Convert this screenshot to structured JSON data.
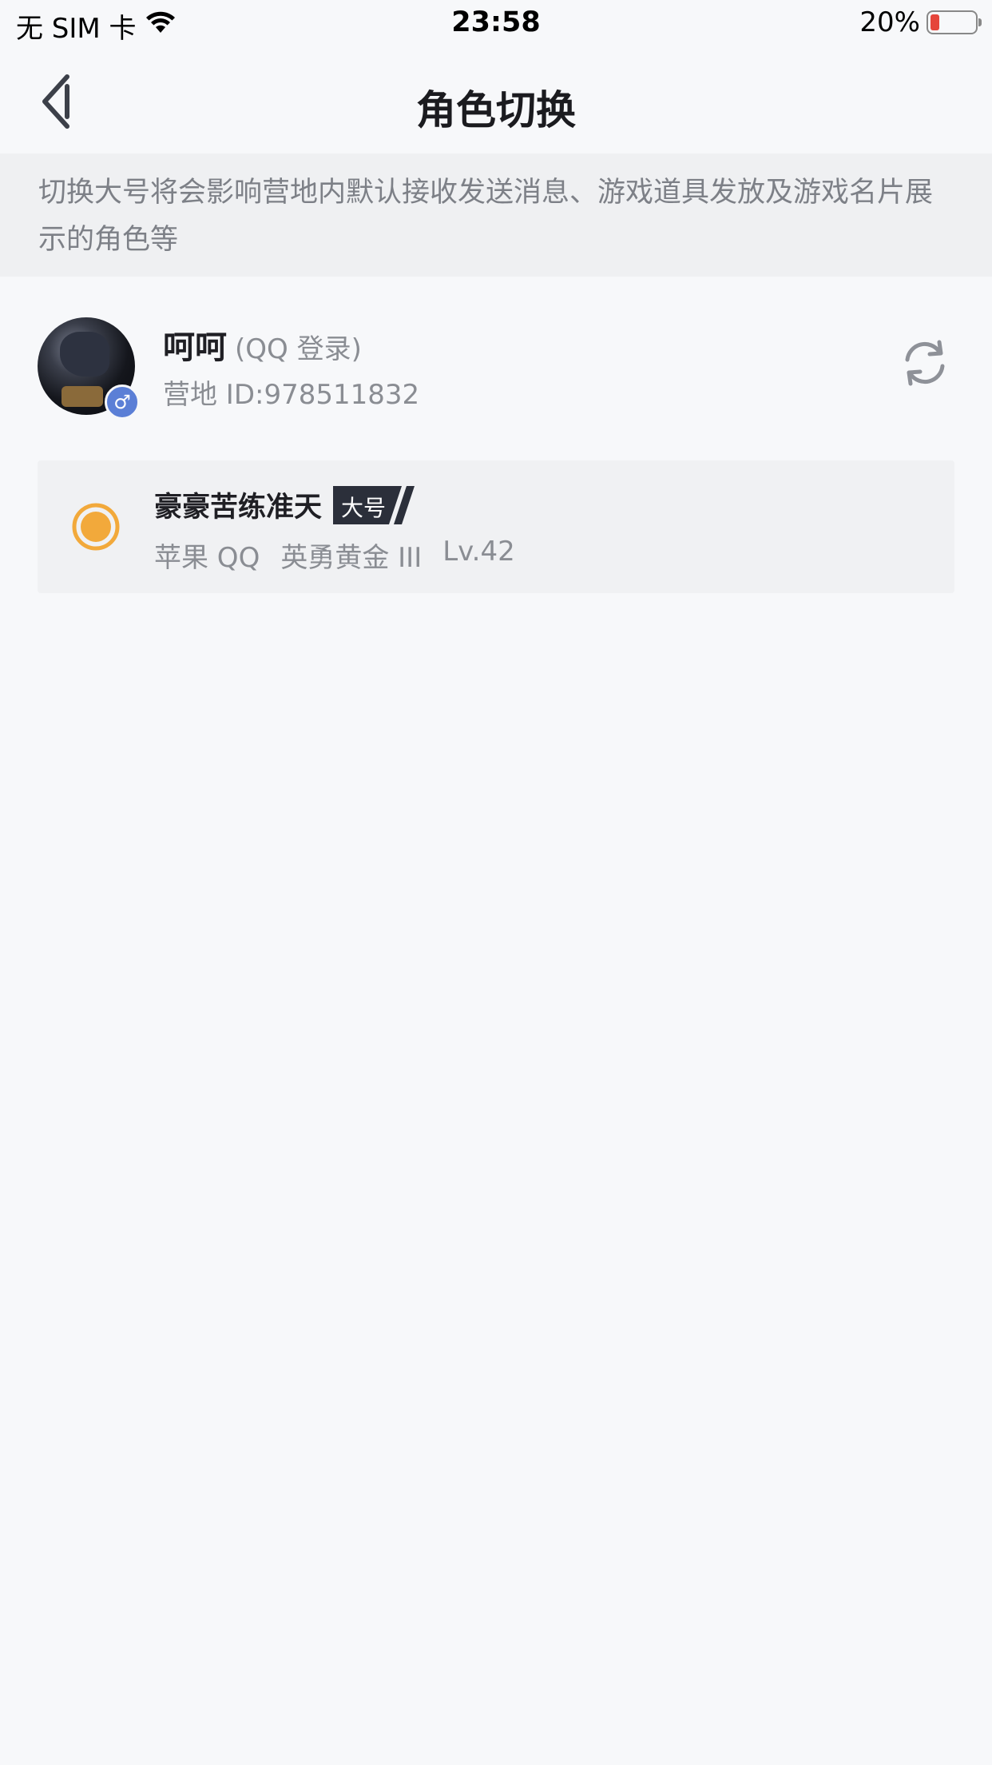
{
  "status_bar": {
    "carrier": "无 SIM 卡",
    "time": "23:58",
    "battery": "20%",
    "battery_level": 0.2,
    "icons": [
      "wifi-icon",
      "battery-icon"
    ]
  },
  "nav": {
    "title": "角色切换",
    "back_icon": "chevron-left-icon"
  },
  "notice": {
    "text": "切换大号将会影响营地内默认接收发送消息、游戏道具发放及游戏名片展示的角色等"
  },
  "account": {
    "name": "呵呵",
    "login": "(QQ 登录)",
    "id": "营地 ID:978511832",
    "gender_symbol": "♂",
    "switch_icon": "refresh-icon"
  },
  "role": {
    "name": "豪豪苦练准天",
    "badge": "大号",
    "platform": "苹果 QQ",
    "rank": "英勇黄金 III",
    "level": "Lv.42",
    "selected": true
  },
  "colors": {
    "accent": "#f2a93b",
    "badge_bg": "#2b2f3a",
    "gender": "#5b7fd6",
    "battery_low": "#e5453b"
  }
}
